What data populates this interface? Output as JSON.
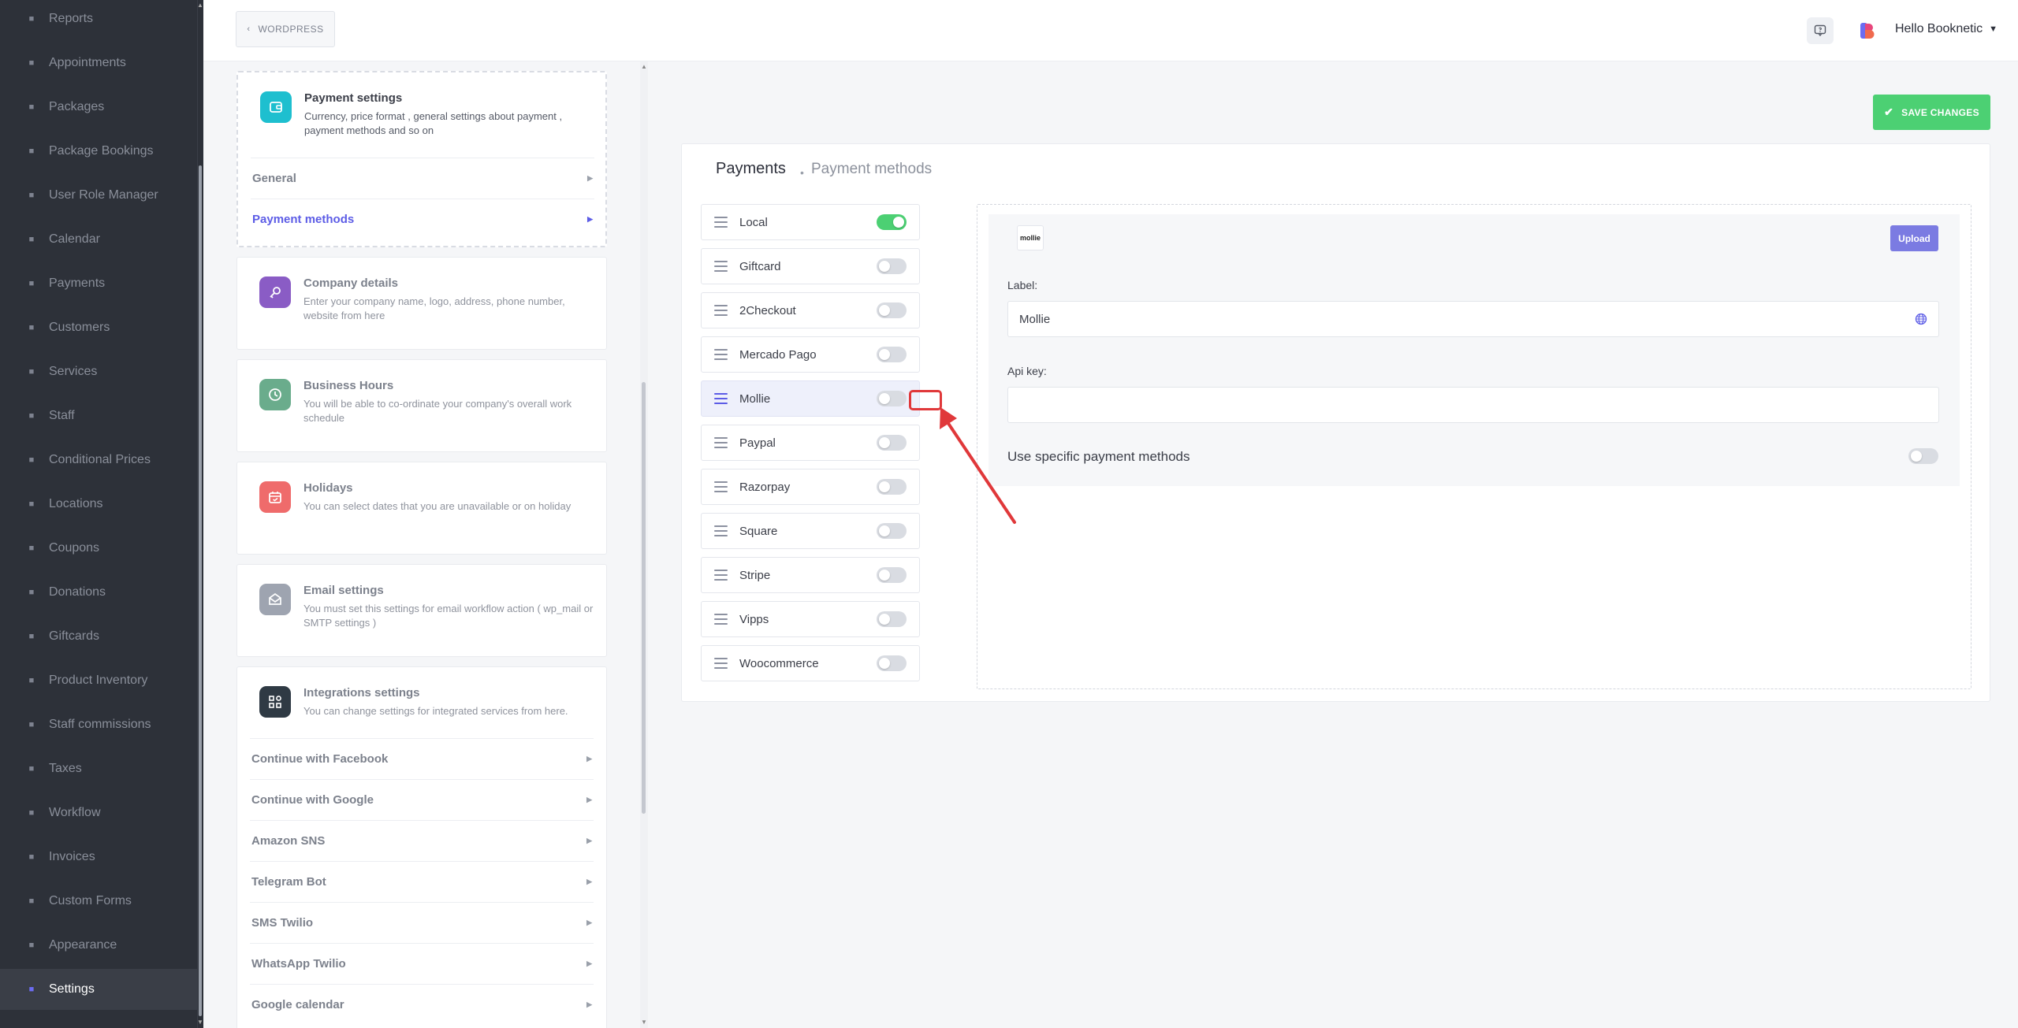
{
  "sidebar": {
    "items": [
      {
        "label": "Reports",
        "icon": "reports-icon"
      },
      {
        "label": "Appointments",
        "icon": "appointments-icon"
      },
      {
        "label": "Packages",
        "icon": "packages-icon"
      },
      {
        "label": "Package Bookings",
        "icon": "package-bookings-icon"
      },
      {
        "label": "User Role Manager",
        "icon": "user-role-icon"
      },
      {
        "label": "Calendar",
        "icon": "calendar-icon"
      },
      {
        "label": "Payments",
        "icon": "payments-icon"
      },
      {
        "label": "Customers",
        "icon": "customers-icon"
      },
      {
        "label": "Services",
        "icon": "services-icon"
      },
      {
        "label": "Staff",
        "icon": "staff-icon"
      },
      {
        "label": "Conditional Prices",
        "icon": "conditional-prices-icon"
      },
      {
        "label": "Locations",
        "icon": "locations-icon"
      },
      {
        "label": "Coupons",
        "icon": "coupons-icon"
      },
      {
        "label": "Donations",
        "icon": "donations-icon"
      },
      {
        "label": "Giftcards",
        "icon": "giftcards-icon"
      },
      {
        "label": "Product Inventory",
        "icon": "product-inventory-icon"
      },
      {
        "label": "Staff commissions",
        "icon": "staff-commissions-icon"
      },
      {
        "label": "Taxes",
        "icon": "taxes-icon"
      },
      {
        "label": "Workflow",
        "icon": "workflow-icon"
      },
      {
        "label": "Invoices",
        "icon": "invoices-icon"
      },
      {
        "label": "Custom Forms",
        "icon": "custom-forms-icon"
      },
      {
        "label": "Appearance",
        "icon": "appearance-icon"
      },
      {
        "label": "Settings",
        "icon": "settings-icon",
        "active": true
      }
    ]
  },
  "topbar": {
    "back_label": "WORDPRESS",
    "user_greeting": "Hello Booknetic"
  },
  "settings": {
    "payment": {
      "title": "Payment settings",
      "desc": "Currency, price format , general settings about payment , payment methods and so on",
      "links": [
        "General",
        "Payment methods"
      ]
    },
    "company": {
      "title": "Company details",
      "desc": "Enter your company name, logo, address, phone number, website from here"
    },
    "hours": {
      "title": "Business Hours",
      "desc": "You will be able to co-ordinate your company's overall work schedule"
    },
    "holidays": {
      "title": "Holidays",
      "desc": "You can select dates that you are unavailable or on holiday"
    },
    "email": {
      "title": "Email settings",
      "desc": "You must set this settings for email workflow action ( wp_mail or SMTP settings )"
    },
    "integrations": {
      "title": "Integrations settings",
      "desc": "You can change settings for integrated services from here.",
      "links": [
        "Continue with Facebook",
        "Continue with Google",
        "Amazon SNS",
        "Telegram Bot",
        "SMS Twilio",
        "WhatsApp Twilio",
        "Google calendar"
      ]
    }
  },
  "save_label": "SAVE CHANGES",
  "panel": {
    "title": "Payments",
    "subtitle": "Payment methods",
    "methods": [
      {
        "label": "Local",
        "enabled": true
      },
      {
        "label": "Giftcard",
        "enabled": false
      },
      {
        "label": "2Checkout",
        "enabled": false
      },
      {
        "label": "Mercado Pago",
        "enabled": false
      },
      {
        "label": "Mollie",
        "enabled": false,
        "selected": true
      },
      {
        "label": "Paypal",
        "enabled": false
      },
      {
        "label": "Razorpay",
        "enabled": false
      },
      {
        "label": "Square",
        "enabled": false
      },
      {
        "label": "Stripe",
        "enabled": false
      },
      {
        "label": "Vipps",
        "enabled": false
      },
      {
        "label": "Woocommerce",
        "enabled": false
      }
    ]
  },
  "detail": {
    "logo_text": "mollie",
    "upload_label": "Upload",
    "label_caption": "Label:",
    "label_value": "Mollie",
    "api_key_caption": "Api key:",
    "api_key_value": "",
    "use_specific_label": "Use specific payment methods",
    "use_specific_enabled": false
  },
  "colors": {
    "sidebar_bg": "#2d3139",
    "accent": "#5c5ce6",
    "success": "#4cd073",
    "annotation": "#e0383a"
  }
}
